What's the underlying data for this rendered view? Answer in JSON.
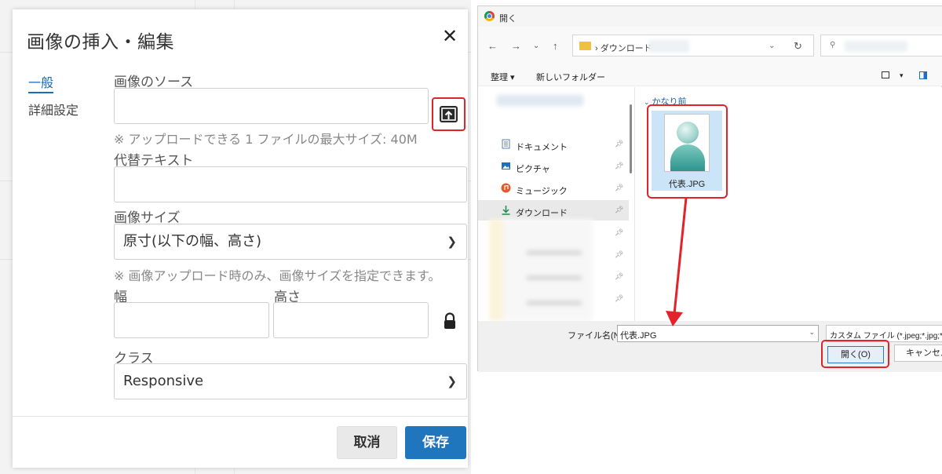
{
  "editor_dialog": {
    "title": "画像の挿入・編集",
    "close_glyph": "✕",
    "nav": {
      "general": "一般",
      "advanced": "詳細設定"
    },
    "source_label": "画像のソース",
    "source_value": "",
    "upload_note": "※ アップロードできる 1 ファイルの最大サイズ: 40M",
    "alt_label": "代替テキスト",
    "alt_value": "",
    "size_label": "画像サイズ",
    "size_selected": "原寸(以下の幅、高さ)",
    "size_note": "※ 画像アップロード時のみ、画像サイズを指定できます。",
    "width_label": "幅",
    "height_label": "高さ",
    "width_value": "",
    "height_value": "",
    "class_label": "クラス",
    "class_selected": "Responsive",
    "cancel_label": "取消",
    "save_label": "保存",
    "accent_color": "#1f76bd",
    "highlight_color": "#e3232a"
  },
  "file_dialog": {
    "title": "開く",
    "breadcrumb": "ダウンロード",
    "toolbar": {
      "organize": "整理 ▾",
      "new_folder": "新しいフォルダー"
    },
    "sidebar": [
      {
        "label": "ドキュメント",
        "icon": "document-icon"
      },
      {
        "label": "ピクチャ",
        "icon": "pictures-icon"
      },
      {
        "label": "ミュージック",
        "icon": "music-icon"
      },
      {
        "label": "ダウンロード",
        "icon": "download-icon",
        "selected": true
      }
    ],
    "group_header": "かなり前",
    "file_name": "代表.JPG",
    "filename_label": "ファイル名(N):",
    "filename_value": "代表.JPG",
    "filetype_value": "カスタム ファイル (*.jpeg;*.jpg;*.pn",
    "open_label": "開く(O)",
    "cancel_label": "キャンセル"
  }
}
